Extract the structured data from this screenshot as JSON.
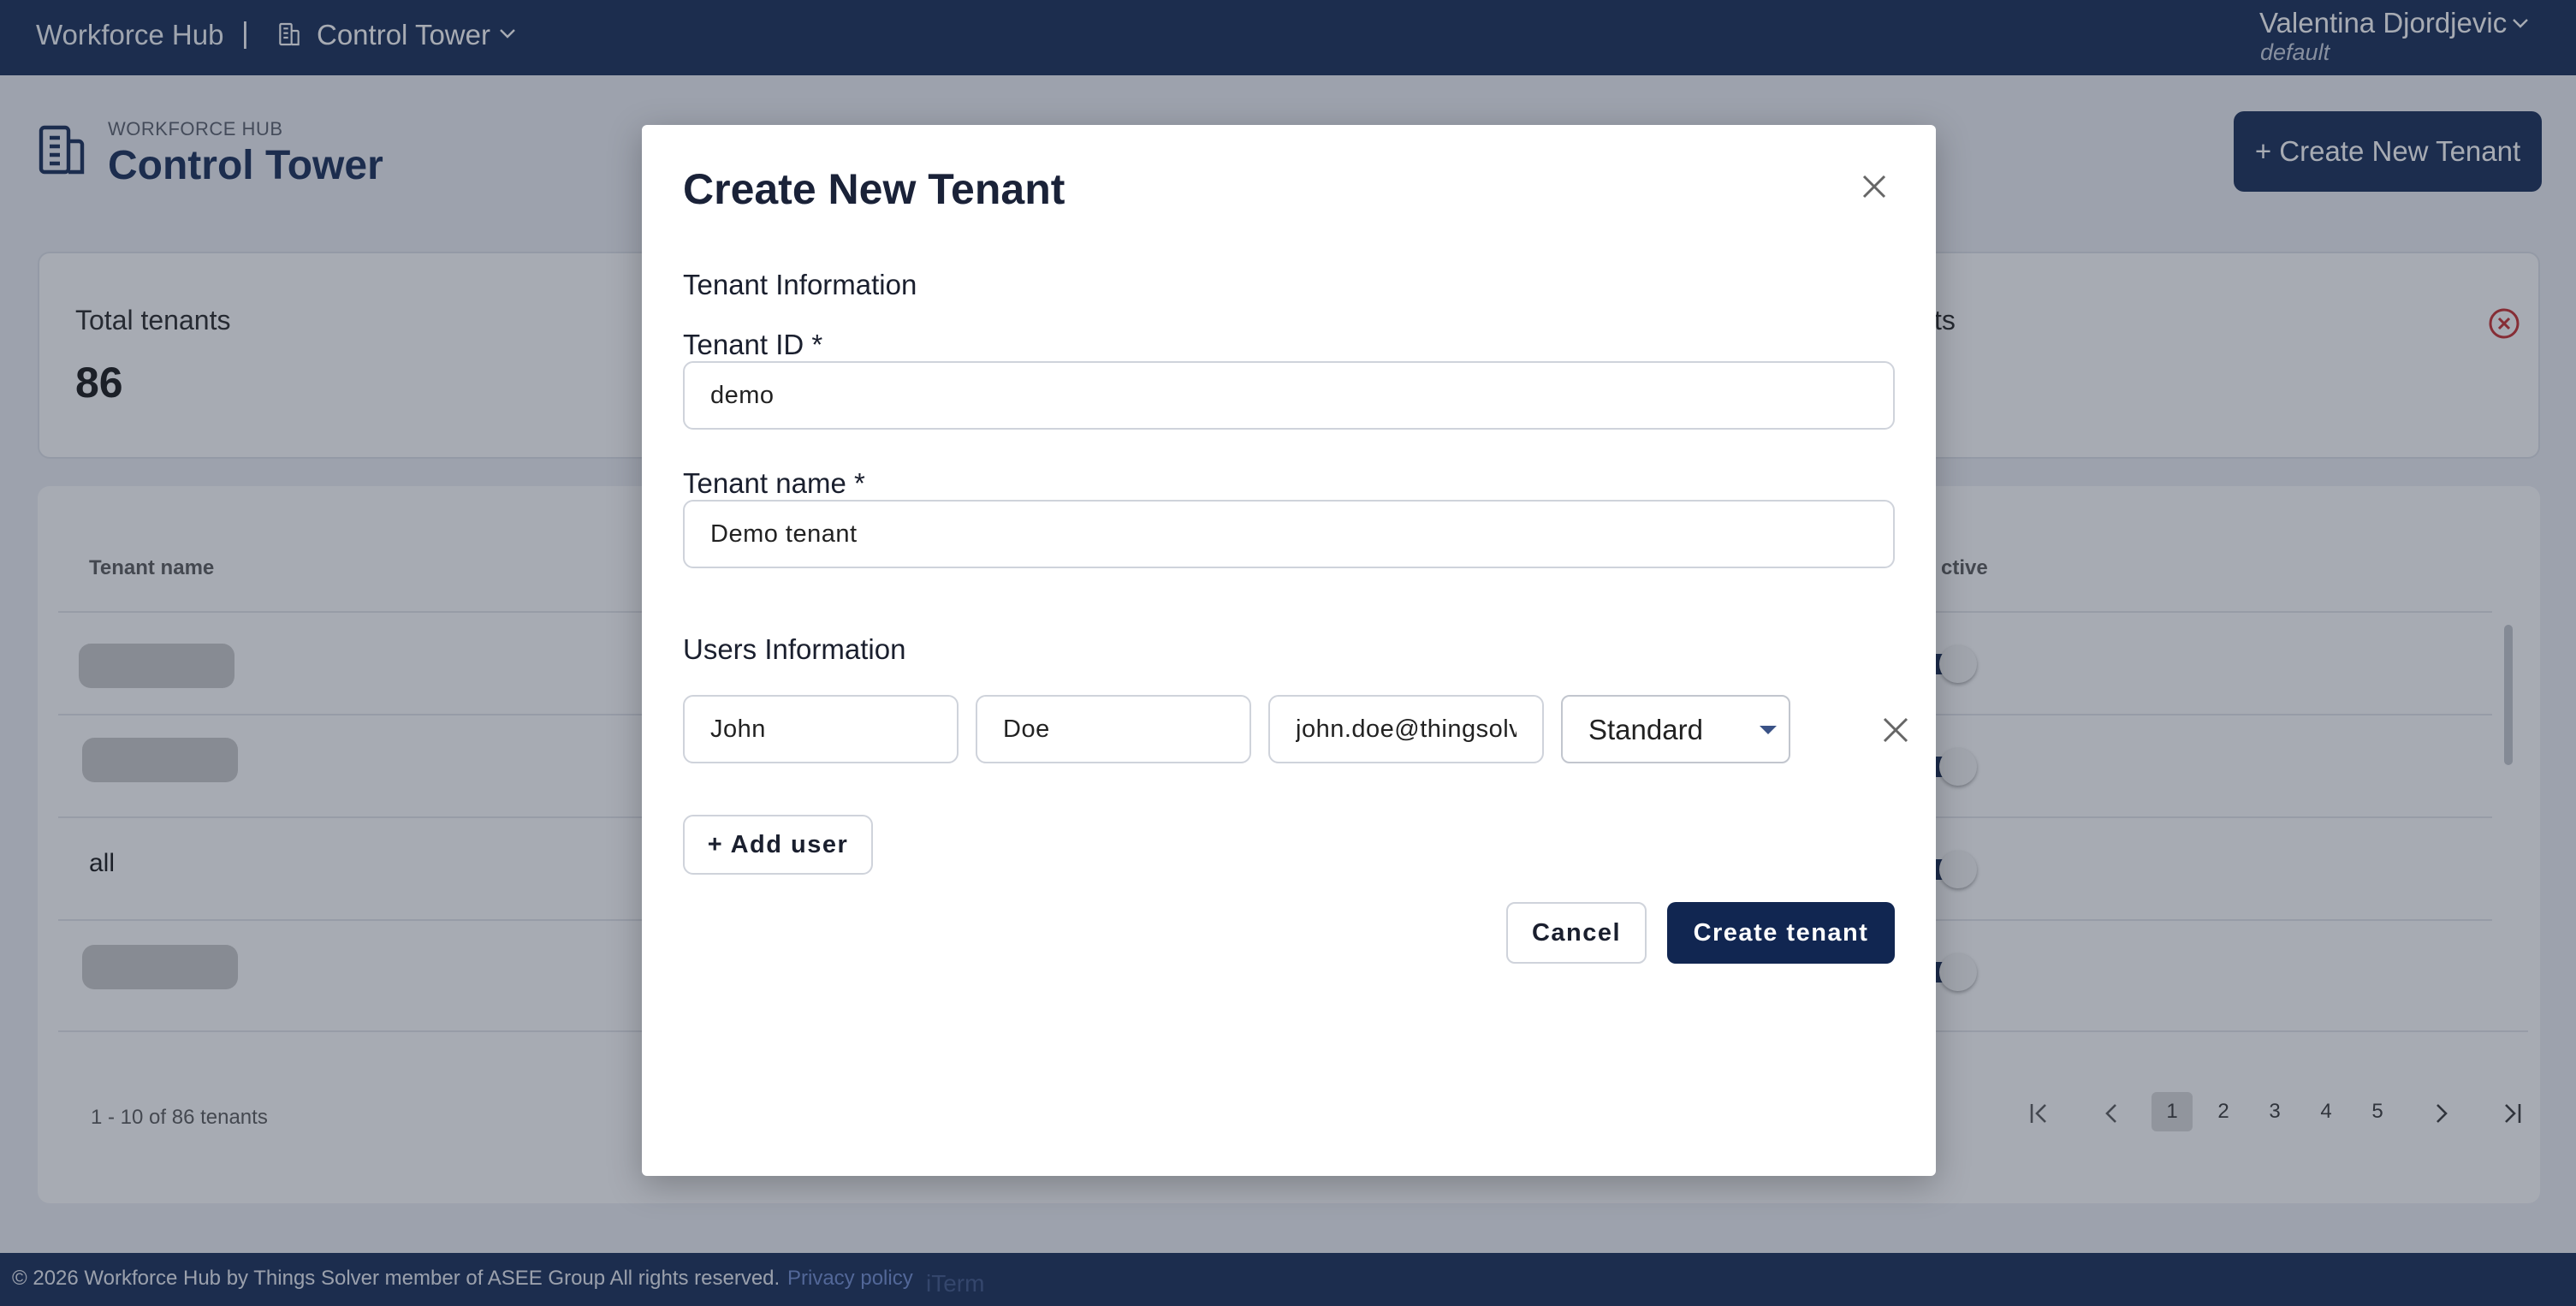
{
  "topbar": {
    "brand": "Workforce Hub",
    "separator": "|",
    "workspace": "Control Tower",
    "workspace_icon": "building-icon",
    "user_name": "Valentina Djordjevic",
    "user_sub": "default"
  },
  "page": {
    "kicker": "WORKFORCE HUB",
    "title": "Control Tower",
    "create_button": "+ Create New Tenant"
  },
  "stats": {
    "total_label": "Total tenants",
    "total_value": "86",
    "second_label_partial": "ts"
  },
  "table": {
    "headers": {
      "name": "Tenant name",
      "active": "ctive"
    },
    "rows": [
      {
        "name": "",
        "skeleton": true
      },
      {
        "name": "",
        "skeleton": true
      },
      {
        "name": "all",
        "skeleton": false
      },
      {
        "name": "",
        "skeleton": true
      }
    ],
    "range_text": "1 - 10 of 86 tenants",
    "pages": [
      "1",
      "2",
      "3",
      "4",
      "5"
    ],
    "current_page": "1"
  },
  "footer": {
    "copyright": "© 2026  Workforce Hub by Things Solver member of ASEE Group All rights reserved.",
    "privacy": "Privacy policy",
    "iterm": "iTerm"
  },
  "modal": {
    "title": "Create New Tenant",
    "tenant_section": "Tenant Information",
    "tenant_id_label": "Tenant ID *",
    "tenant_id_value": "demo",
    "tenant_name_label": "Tenant name *",
    "tenant_name_value": "Demo tenant",
    "users_section": "Users Information",
    "user": {
      "first_name": "John",
      "last_name": "Doe",
      "email": "john.doe@thingsolv",
      "role": "Standard"
    },
    "add_user": "+ Add user",
    "cancel": "Cancel",
    "create": "Create tenant"
  },
  "colors": {
    "navy": "#112651",
    "link": "#6d8bd1",
    "error": "#c62828"
  }
}
